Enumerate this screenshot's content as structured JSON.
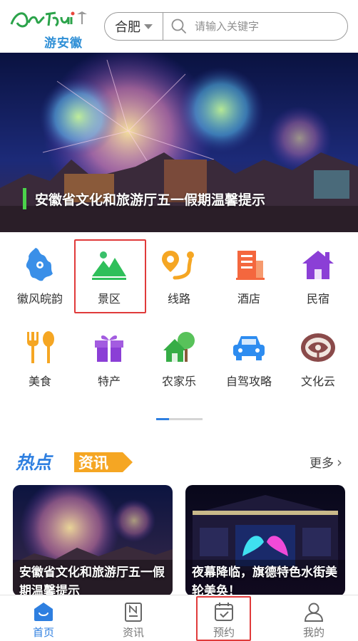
{
  "header": {
    "logo_text": "游安徽",
    "city": "合肥",
    "search_placeholder": "请输入关键字"
  },
  "banner": {
    "title": "安徽省文化和旅游厅五一假期温馨提示"
  },
  "categories": [
    {
      "label": "徽风皖韵",
      "icon": "anhui-map-icon"
    },
    {
      "label": "景区",
      "icon": "mountain-scenery-icon"
    },
    {
      "label": "线路",
      "icon": "route-icon"
    },
    {
      "label": "酒店",
      "icon": "hotel-building-icon"
    },
    {
      "label": "民宿",
      "icon": "house-icon"
    },
    {
      "label": "美食",
      "icon": "fork-spoon-icon"
    },
    {
      "label": "特产",
      "icon": "gift-icon"
    },
    {
      "label": "农家乐",
      "icon": "farm-house-icon"
    },
    {
      "label": "自驾攻略",
      "icon": "car-icon"
    },
    {
      "label": "文化云",
      "icon": "culture-cloud-icon"
    }
  ],
  "pager": {
    "current": 1,
    "total": 2
  },
  "hot_news": {
    "title_part1": "热点",
    "title_part2": "资讯",
    "more_label": "更多",
    "items": [
      {
        "text": "安徽省文化和旅游厅五一假期温馨提示"
      },
      {
        "text": "夜幕降临，旗德特色水街美轮美奂！"
      }
    ]
  },
  "tabbar": {
    "items": [
      {
        "label": "首页",
        "icon": "home-icon",
        "active": true
      },
      {
        "label": "资讯",
        "icon": "news-icon",
        "active": false
      },
      {
        "label": "预约",
        "icon": "calendar-check-icon",
        "active": false
      },
      {
        "label": "我的",
        "icon": "user-icon",
        "active": false
      }
    ]
  },
  "colors": {
    "accent": "#2e7fe0",
    "highlight": "#e03a3a",
    "banner_bar": "#4bd34b"
  }
}
